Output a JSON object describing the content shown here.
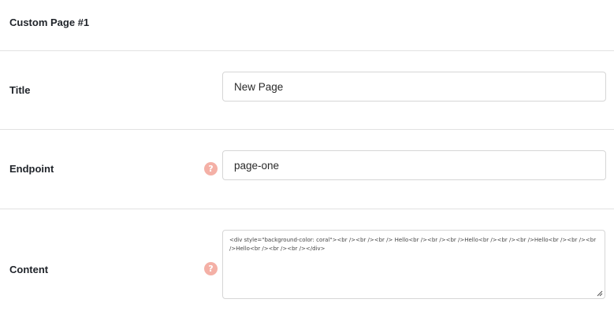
{
  "header": {
    "title": "Custom Page #1"
  },
  "fields": {
    "title": {
      "label": "Title",
      "value": "New Page"
    },
    "endpoint": {
      "label": "Endpoint",
      "value": "page-one",
      "help_icon": "?"
    },
    "content": {
      "label": "Content",
      "value": "<div style=\"background-color: coral\"><br /><br /><br /> Hello<br /><br /><br />Hello<br /><br /><br />Hello<br /><br /><br />Hello<br /><br /><br /></div>",
      "help_icon": "?"
    }
  },
  "colors": {
    "help_icon_bg": "#f4b0a6",
    "divider": "#e2e2e2",
    "input_border": "#d6d6d6"
  }
}
